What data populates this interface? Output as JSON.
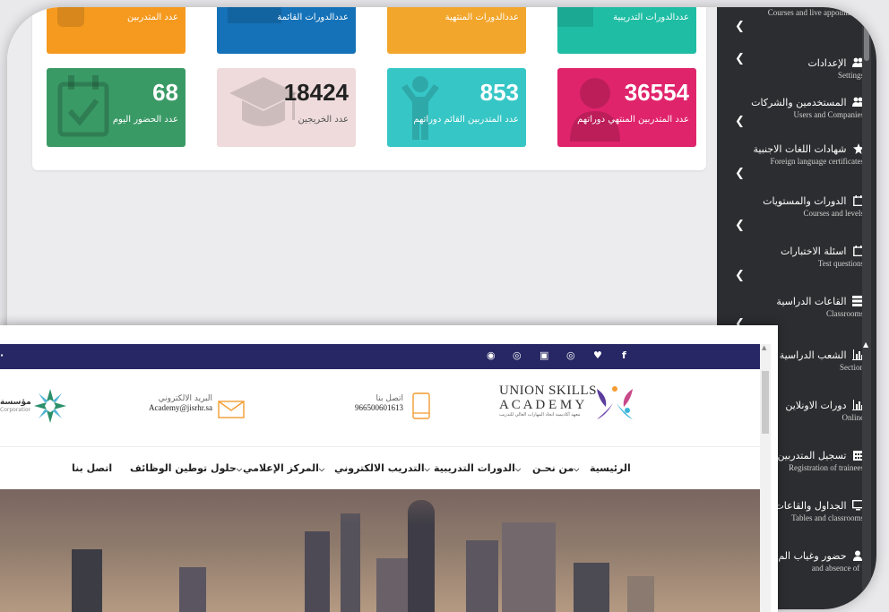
{
  "top_cards": [
    {
      "label": "عدد المتدربين",
      "color": "#f59a1f"
    },
    {
      "label": "عددالدورات القائمة",
      "color": "#1572b8"
    },
    {
      "label": "عددالدورات المنتهية",
      "color": "#f2a62c"
    },
    {
      "label": "عددالدورات التدريبية",
      "color": "#1fbda4"
    }
  ],
  "stat_cards": [
    {
      "value": "68",
      "label": "عدد الحضور اليوم",
      "color": "#3a9a66",
      "icon": "calendar-check-icon"
    },
    {
      "value": "18424",
      "label": "عدد الخريجين",
      "color": "#efdbdb",
      "icon": "graduation-cap-icon"
    },
    {
      "value": "853",
      "label": "عدد المتدربين القائم دوراتهم",
      "color": "#37c6c6",
      "icon": "person-standing-icon"
    },
    {
      "value": "36554",
      "label": "عدد المتدربين المنتهي دوراتهم",
      "color": "#e0246c",
      "icon": "user-icon"
    }
  ],
  "sidebar": {
    "items": [
      {
        "ar": "",
        "en": "Courses and live appointment",
        "icon": "video-icon"
      },
      {
        "ar": "الإعدادات",
        "en": "Settings",
        "icon": "users-icon"
      },
      {
        "ar": "المستخدمين والشركات",
        "en": "Users and Companies",
        "icon": "users-icon"
      },
      {
        "ar": "شهادات اللغات الاجنبية",
        "en": "Foreign language certificates",
        "icon": "certificate-icon"
      },
      {
        "ar": "الدورات والمستويات",
        "en": "Courses and levels",
        "icon": "calendar-icon"
      },
      {
        "ar": "اسئلة الاختبارات",
        "en": "Test questions",
        "icon": "calendar-icon"
      },
      {
        "ar": "القاعات الدراسية",
        "en": "Classrooms",
        "icon": "server-icon"
      },
      {
        "ar": "الشعب الدراسية",
        "en": "Section",
        "icon": "bar-chart-icon"
      },
      {
        "ar": "دورات الاونلاين",
        "en": "Online",
        "icon": "bar-chart-icon"
      },
      {
        "ar": "تسجيل المتدربين",
        "en": "Registration of trainees",
        "icon": "calendar-grid-icon"
      },
      {
        "ar": "الجداول والقاعات",
        "en": "Tables and classrooms",
        "icon": "monitor-icon"
      },
      {
        "ar": "حضور وغياب الم",
        "en": "and absence of t",
        "icon": "user-check-icon"
      }
    ]
  },
  "website": {
    "social": [
      "facebook-icon",
      "twitter-icon",
      "whatsapp-icon",
      "youtube-icon",
      "instagram-icon",
      "snapchat-icon"
    ],
    "logo_line1": "UNION SKILLS",
    "logo_line2": "A C A D E M Y",
    "logo_tagline": "معهد أكاديمية اتحاد المهارات العالي للتدريب",
    "contact_label": "اتصل بنا",
    "contact_value": "966500601613",
    "email_label": "البريد الالكتروني",
    "email_value": "Academy@jisrhr.sa",
    "partner_label": "المؤسسة",
    "partner_sub": "Corporation",
    "nav": [
      "الرئيسية",
      "من نحـن",
      "الدورات التدريبية",
      "التدريب الالكتروني",
      "المركز الإعلامي",
      "حلول توطين الوظائف",
      "اتصل بنا"
    ]
  }
}
